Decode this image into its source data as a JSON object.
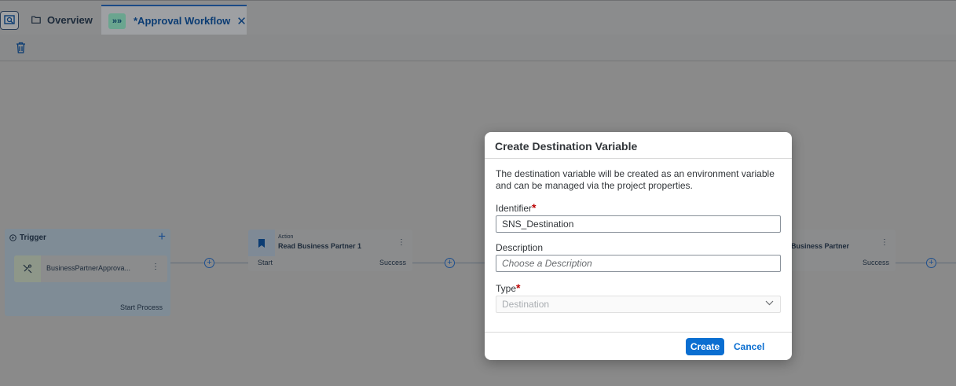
{
  "tabs": {
    "overview_label": "Overview",
    "active_label": "*Approval Workflow",
    "active_badge": "»»",
    "close_glyph": "✕"
  },
  "toolbar": {
    "delete_icon": "trash-icon"
  },
  "canvas": {
    "trigger": {
      "title": "Trigger",
      "item_label": "BusinessPartnerApprova...",
      "footer": "Start Process"
    },
    "action1": {
      "small": "Action",
      "title": "Read Business Partner 1",
      "start": "Start",
      "success": "Success"
    },
    "action2": {
      "title": "Business Partner",
      "success": "Success"
    }
  },
  "dialog": {
    "title": "Create Destination Variable",
    "description": "The destination variable will be created as an environment variable and can be managed via the project properties.",
    "identifier_label": "Identifier",
    "identifier_value": "SNS_Destination",
    "description_label": "Description",
    "description_placeholder": "Choose a Description",
    "type_label": "Type",
    "type_placeholder": "Destination",
    "required_mark": "*",
    "create_label": "Create",
    "cancel_label": "Cancel"
  },
  "colors": {
    "accent": "#0a6ed1",
    "required": "#bb0000"
  }
}
